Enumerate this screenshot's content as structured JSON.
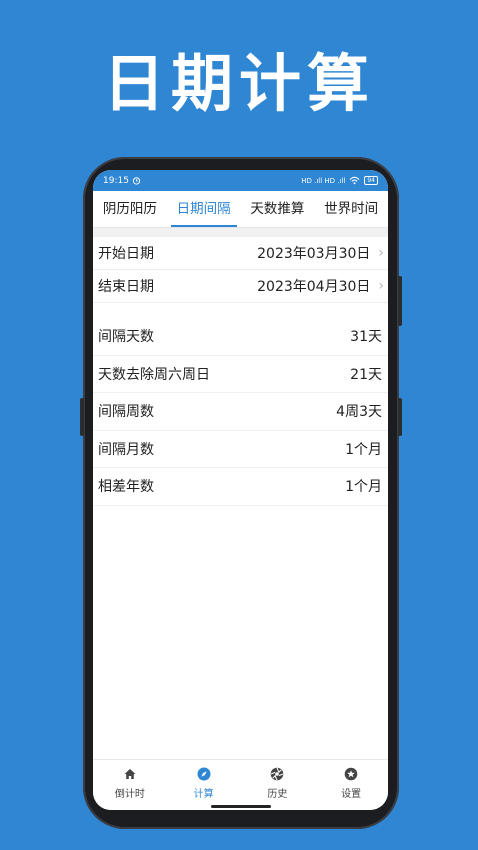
{
  "headline": "日期计算",
  "status": {
    "time": "19:15",
    "signal": "HD .ıll HD .ıll",
    "battery": "94"
  },
  "tabs": [
    {
      "label": "阴历阳历"
    },
    {
      "label": "日期间隔"
    },
    {
      "label": "天数推算"
    },
    {
      "label": "世界时间"
    }
  ],
  "active_tab": "日期间隔",
  "dates": {
    "start": {
      "label": "开始日期",
      "value": "2023年03月30日"
    },
    "end": {
      "label": "结束日期",
      "value": "2023年04月30日"
    }
  },
  "results": [
    {
      "label": "间隔天数",
      "value": "31天"
    },
    {
      "label": "天数去除周六周日",
      "value": "21天"
    },
    {
      "label": "间隔周数",
      "value": "4周3天"
    },
    {
      "label": "间隔月数",
      "value": "1个月"
    },
    {
      "label": "相差年数",
      "value": "1个月"
    }
  ],
  "nav": [
    {
      "label": "倒计时",
      "icon": "home-icon"
    },
    {
      "label": "计算",
      "icon": "compass-icon"
    },
    {
      "label": "历史",
      "icon": "aperture-icon"
    },
    {
      "label": "设置",
      "icon": "star-circle-icon"
    }
  ],
  "colors": {
    "accent": "#2f86d3",
    "background": "#2f86d3"
  }
}
